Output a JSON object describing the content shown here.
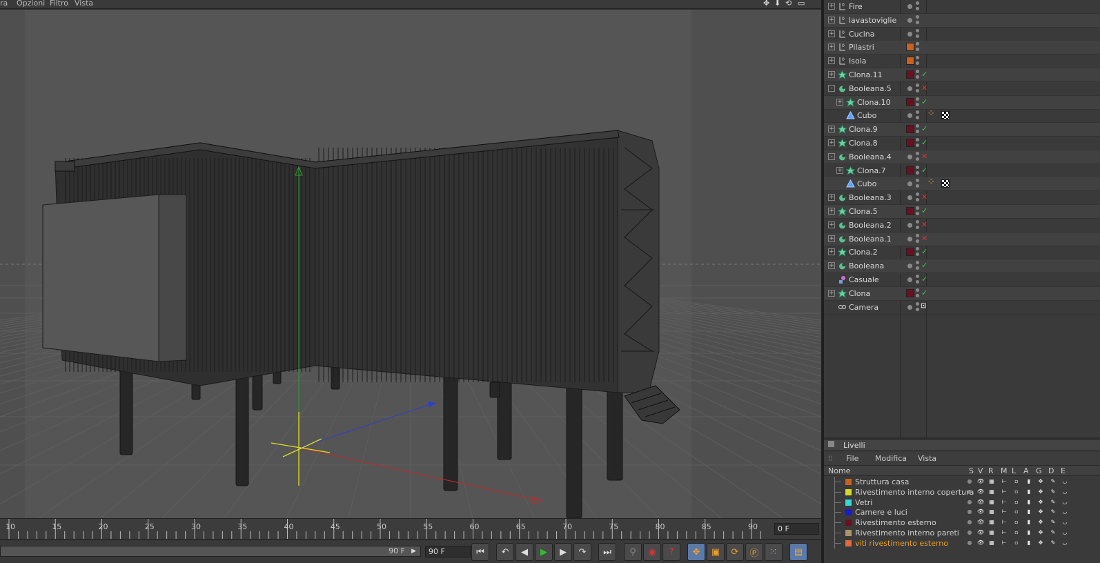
{
  "viewport_menu": {
    "items": [
      "ra",
      "Opzioni",
      "Filtro",
      "Vista"
    ]
  },
  "timeline": {
    "ticks": [
      "10",
      "15",
      "20",
      "25",
      "30",
      "35",
      "40",
      "45",
      "50",
      "55",
      "60",
      "65",
      "70",
      "75",
      "80",
      "85",
      "90"
    ],
    "current_frame": "0 F"
  },
  "controls": {
    "range_end": "90 F",
    "end_frame": "90 F"
  },
  "objects": [
    {
      "name": "Fire",
      "icon": "null-icon",
      "tree": "+",
      "swatch": null,
      "tag": null,
      "extra": null
    },
    {
      "name": "lavastoviglie",
      "icon": "null-icon",
      "tree": "+",
      "swatch": null,
      "tag": null,
      "extra": null
    },
    {
      "name": "Cucina",
      "icon": "null-icon",
      "tree": "+",
      "swatch": null,
      "tag": null,
      "extra": null
    },
    {
      "name": "Pilastri",
      "icon": "null-icon",
      "tree": "+",
      "swatch": "#c8611f",
      "tag": null,
      "extra": null
    },
    {
      "name": "Isola",
      "icon": "null-icon",
      "tree": "+",
      "swatch": "#c8611f",
      "tag": null,
      "extra": null
    },
    {
      "name": "Clona.11",
      "icon": "cloner-icon",
      "tree": "+",
      "swatch": "#6b1020",
      "tag": "check",
      "extra": null
    },
    {
      "name": "Booleana.5",
      "icon": "boole-icon",
      "tree": "-",
      "swatch": null,
      "tag": "cross",
      "extra": null
    },
    {
      "name": "Clona.10",
      "icon": "cloner-icon",
      "tree": "+",
      "swatch": "#6b1020",
      "tag": "check",
      "extra": null,
      "indent": 1
    },
    {
      "name": "Cubo",
      "icon": "cube-icon",
      "tree": "",
      "swatch": null,
      "tag": null,
      "extra": "material",
      "indent": 1
    },
    {
      "name": "Clona.9",
      "icon": "cloner-icon",
      "tree": "+",
      "swatch": "#6b1020",
      "tag": "check",
      "extra": null
    },
    {
      "name": "Clona.8",
      "icon": "cloner-icon",
      "tree": "+",
      "swatch": "#6b1020",
      "tag": "check",
      "extra": null
    },
    {
      "name": "Booleana.4",
      "icon": "boole-icon",
      "tree": "-",
      "swatch": null,
      "tag": "cross",
      "extra": null
    },
    {
      "name": "Clona.7",
      "icon": "cloner-icon",
      "tree": "+",
      "swatch": "#6b1020",
      "tag": "check",
      "extra": null,
      "indent": 1
    },
    {
      "name": "Cubo",
      "icon": "cube-icon",
      "tree": "",
      "swatch": null,
      "tag": null,
      "extra": "material",
      "indent": 1
    },
    {
      "name": "Booleana.3",
      "icon": "boole-icon",
      "tree": "+",
      "swatch": null,
      "tag": "cross",
      "extra": null
    },
    {
      "name": "Clona.5",
      "icon": "cloner-icon",
      "tree": "+",
      "swatch": "#6b1020",
      "tag": "check",
      "extra": null
    },
    {
      "name": "Booleana.2",
      "icon": "boole-icon",
      "tree": "+",
      "swatch": null,
      "tag": "cross",
      "extra": null
    },
    {
      "name": "Booleana.1",
      "icon": "boole-icon",
      "tree": "+",
      "swatch": null,
      "tag": "cross",
      "extra": null
    },
    {
      "name": "Clona.2",
      "icon": "cloner-icon",
      "tree": "+",
      "swatch": "#6b1020",
      "tag": "check",
      "extra": null
    },
    {
      "name": "Booleana",
      "icon": "boole-icon",
      "tree": "+",
      "swatch": null,
      "tag": "check",
      "extra": null
    },
    {
      "name": "Casuale",
      "icon": "random-icon",
      "tree": "",
      "swatch": null,
      "tag": "check",
      "extra": null
    },
    {
      "name": "Clona",
      "icon": "cloner-icon",
      "tree": "+",
      "swatch": "#6b1020",
      "tag": "check",
      "extra": null
    },
    {
      "name": "Camera",
      "icon": "camera-icon",
      "tree": "",
      "swatch": null,
      "tag": "target",
      "extra": null
    }
  ],
  "layers": {
    "title": "Livelli",
    "menu": [
      "File",
      "Modifica",
      "Vista"
    ],
    "name_header": "Nome",
    "col_headers": [
      "S",
      "V",
      "R",
      "M",
      "L",
      "A",
      "G",
      "D",
      "E"
    ],
    "items": [
      {
        "name": "Struttura casa",
        "color": "#c8611f"
      },
      {
        "name": "Rivestimento interno copertura",
        "color": "#d8d82a"
      },
      {
        "name": "Vetri",
        "color": "#36d8d8"
      },
      {
        "name": "Camere e luci",
        "color": "#1a1ad0"
      },
      {
        "name": "Rivestimento esterno",
        "color": "#6b1020"
      },
      {
        "name": "Rivestimento interno pareti",
        "color": "#a8956a"
      },
      {
        "name": "viti rivestimento esterno",
        "color": "#e06a3a",
        "active": true
      }
    ]
  }
}
